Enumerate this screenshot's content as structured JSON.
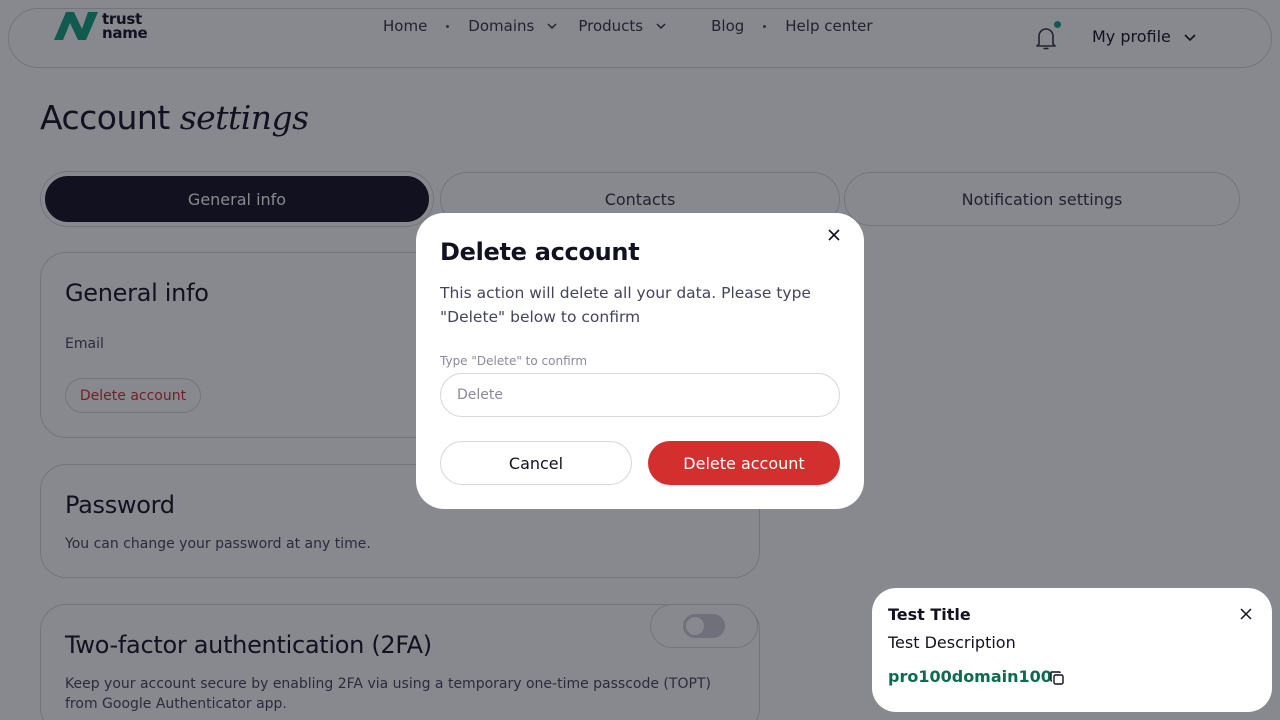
{
  "header": {
    "logo_line1": "trust",
    "logo_line2": "name",
    "nav": [
      {
        "label": "Home",
        "has_dropdown": false
      },
      {
        "label": "Domains",
        "has_dropdown": true
      },
      {
        "label": "Products",
        "has_dropdown": true
      },
      {
        "label": "Blog",
        "has_dropdown": false
      },
      {
        "label": "Help center",
        "has_dropdown": false
      }
    ],
    "profile_label": "My profile",
    "notification_indicator": true
  },
  "page": {
    "title_plain": "Account",
    "title_italic": "settings",
    "tabs": [
      {
        "label": "General info",
        "active": true
      },
      {
        "label": "Contacts",
        "active": false
      },
      {
        "label": "Notification settings",
        "active": false
      }
    ]
  },
  "general_info": {
    "title": "General info",
    "email_label": "Email",
    "delete_button": "Delete account"
  },
  "password": {
    "title": "Password",
    "description": "You can change your password at any time."
  },
  "two_factor": {
    "title": "Two-factor authentication (2FA)",
    "description": "Keep your account secure by enabling 2FA via using a temporary one-time passcode (TOPT) from Google Authenticator app.",
    "enabled": false
  },
  "modal": {
    "title": "Delete account",
    "description": "This action will delete all your data. Please type \"Delete\" below to confirm",
    "field_label": "Type \"Delete\" to confirm",
    "field_placeholder": "Delete",
    "field_value": "",
    "cancel_label": "Cancel",
    "confirm_label": "Delete account"
  },
  "toast": {
    "title": "Test Title",
    "description": "Test Description",
    "code": "pro100domain100"
  },
  "colors": {
    "brand_green": "#0fa37f",
    "danger": "#d32f2f",
    "dark": "#11111f",
    "code_green": "#0b6b4f"
  }
}
